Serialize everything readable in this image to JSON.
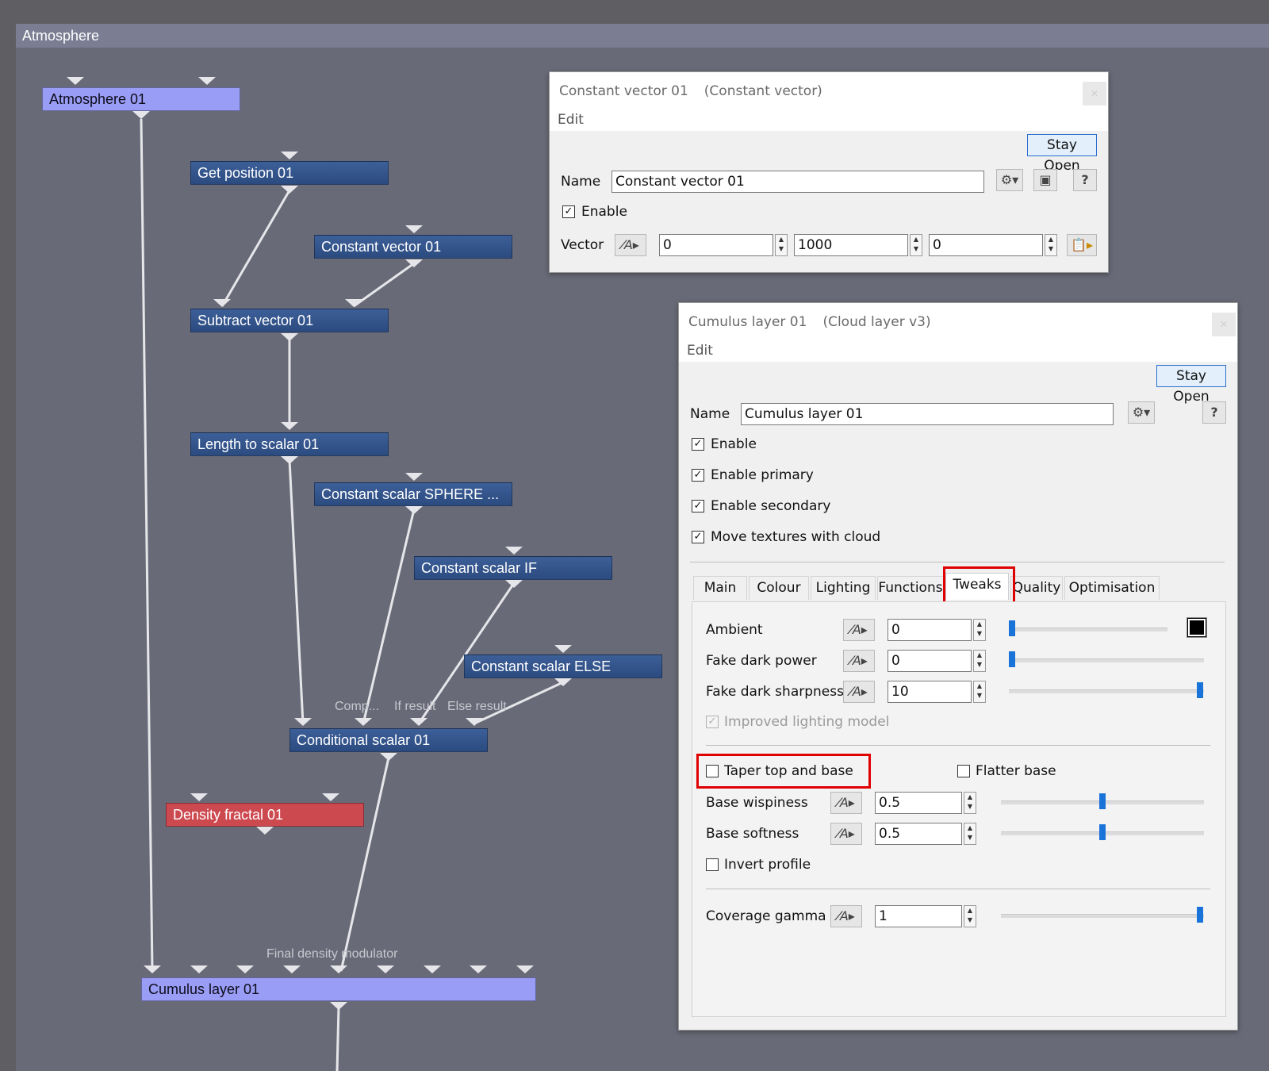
{
  "graph": {
    "title": "Atmosphere",
    "nodes": [
      {
        "id": "atmosphere",
        "label": "Atmosphere 01"
      },
      {
        "id": "getpos",
        "label": "Get position 01"
      },
      {
        "id": "constvec",
        "label": "Constant vector 01"
      },
      {
        "id": "subvec",
        "label": "Subtract vector 01"
      },
      {
        "id": "lenscalar",
        "label": "Length to scalar 01"
      },
      {
        "id": "sphere",
        "label": "Constant scalar SPHERE ..."
      },
      {
        "id": "csif",
        "label": "Constant scalar IF"
      },
      {
        "id": "cselse",
        "label": "Constant scalar ELSE"
      },
      {
        "id": "cond",
        "label": "Conditional scalar 01"
      },
      {
        "id": "density",
        "label": "Density fractal 01"
      },
      {
        "id": "cumulus",
        "label": "Cumulus layer 01"
      }
    ],
    "port_labels": {
      "comp": "Comp...",
      "if_result": "If result",
      "else_result": "Else result",
      "final_density": "Final density modulator"
    }
  },
  "dialog_vector": {
    "title": "Constant vector 01",
    "type": "(Constant vector)",
    "menu": "Edit",
    "stay_open": "Stay Open",
    "name_label": "Name",
    "name_value": "Constant vector 01",
    "enable_label": "Enable",
    "enable_checked": true,
    "vector_label": "Vector",
    "vector_values": [
      "0",
      "1000",
      "0"
    ],
    "help": "?"
  },
  "dialog_cumulus": {
    "title": "Cumulus layer 01",
    "type": "(Cloud layer v3)",
    "menu": "Edit",
    "stay_open": "Stay Open",
    "name_label": "Name",
    "name_value": "Cumulus layer 01",
    "help": "?",
    "checks": [
      {
        "label": "Enable",
        "checked": true
      },
      {
        "label": "Enable primary",
        "checked": true
      },
      {
        "label": "Enable secondary",
        "checked": true
      },
      {
        "label": "Move textures with cloud",
        "checked": true
      }
    ],
    "tabs": [
      "Main",
      "Colour",
      "Lighting",
      "Functions",
      "Tweaks",
      "Quality",
      "Optimisation"
    ],
    "active_tab": "Tweaks",
    "params": [
      {
        "label": "Ambient",
        "value": "0",
        "slider": 0.0
      },
      {
        "label": "Fake dark power",
        "value": "0",
        "slider": 0.0
      },
      {
        "label": "Fake dark sharpness",
        "value": "10",
        "slider": 1.0
      }
    ],
    "improved_lighting": {
      "label": "Improved lighting model",
      "checked": true,
      "disabled": true
    },
    "taper": {
      "label": "Taper top and base",
      "checked": false
    },
    "flatter": {
      "label": "Flatter base",
      "checked": false
    },
    "base_params": [
      {
        "label": "Base wispiness",
        "value": "0.5",
        "slider": 0.5
      },
      {
        "label": "Base softness",
        "value": "0.5",
        "slider": 0.5
      }
    ],
    "invert": {
      "label": "Invert profile",
      "checked": false
    },
    "coverage": {
      "label": "Coverage gamma",
      "value": "1",
      "slider": 1.0
    }
  },
  "colors": {
    "highlight": "#e00000",
    "node_blue": "#2f4f86",
    "node_lavender": "#9a9df5",
    "node_red": "#cd4950",
    "accent": "#1a73d9"
  }
}
